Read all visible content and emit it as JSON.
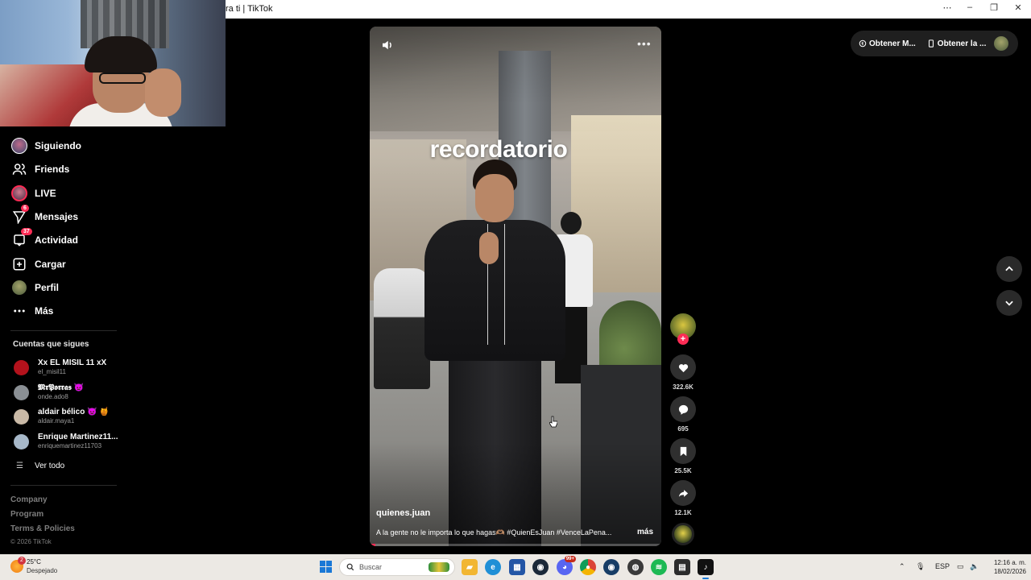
{
  "window": {
    "title": "ra ti | TikTok",
    "controls": {
      "more": "⋯",
      "minimize": "–",
      "restore": "❐",
      "close": "✕"
    }
  },
  "sidebar": {
    "nav": [
      {
        "label": "Siguiendo",
        "icon": "following-avatar-icon"
      },
      {
        "label": "Friends",
        "icon": "friends-icon"
      },
      {
        "label": "LIVE",
        "icon": "live-icon"
      },
      {
        "label": "Mensajes",
        "icon": "messages-icon",
        "badge": "6"
      },
      {
        "label": "Actividad",
        "icon": "activity-icon",
        "badge": "37"
      },
      {
        "label": "Cargar",
        "icon": "upload-icon"
      },
      {
        "label": "Perfil",
        "icon": "profile-icon"
      },
      {
        "label": "Más",
        "icon": "more-icon"
      }
    ],
    "following_title": "Cuentas que sigues",
    "following": [
      {
        "name": "Xx EL MISIL 11 xX",
        "handle": "el_misil11",
        "color": "#b3121c"
      },
      {
        "name": "𝕸𝖗𝕻𝖔𝖗𝖗𝖆𝖘 👿",
        "handle": "onde.ado8",
        "color": "#8a8f94"
      },
      {
        "name": "aldair bélico 👿 🍯",
        "handle": "aldair.maya1",
        "color": "#c9b9a6"
      },
      {
        "name": "Enrique Martinez11...",
        "handle": "enriquemartinez11703",
        "color": "#a7b8c9"
      }
    ],
    "see_all": "Ver todo",
    "footer_links": [
      "Company",
      "Program",
      "Terms & Policies"
    ],
    "copyright": "© 2026 TikTok"
  },
  "video": {
    "overlay_text": "recordatorio",
    "author": "quienes.juan",
    "description": "A la gente no le importa lo que hagas🫶🏽 #QuienEsJuan #VenceLaPena...",
    "more_label": "más",
    "progress": 0.02
  },
  "actions": {
    "likes": "322.6K",
    "comments": "695",
    "saves": "25.5K",
    "shares": "12.1K"
  },
  "topbar": {
    "get_coins": "Obtener M...",
    "get_app": "Obtener la ..."
  },
  "taskbar": {
    "weather_temp": "25°C",
    "weather_cond": "Despejado",
    "weather_badge": "2",
    "search_placeholder": "Buscar",
    "discord_badge": "99+",
    "lang": "ESP",
    "time": "12:16 a. m.",
    "date": "18/02/2026"
  },
  "colors": {
    "accent": "#fe2c55",
    "taskbar": "#ece9e4"
  }
}
